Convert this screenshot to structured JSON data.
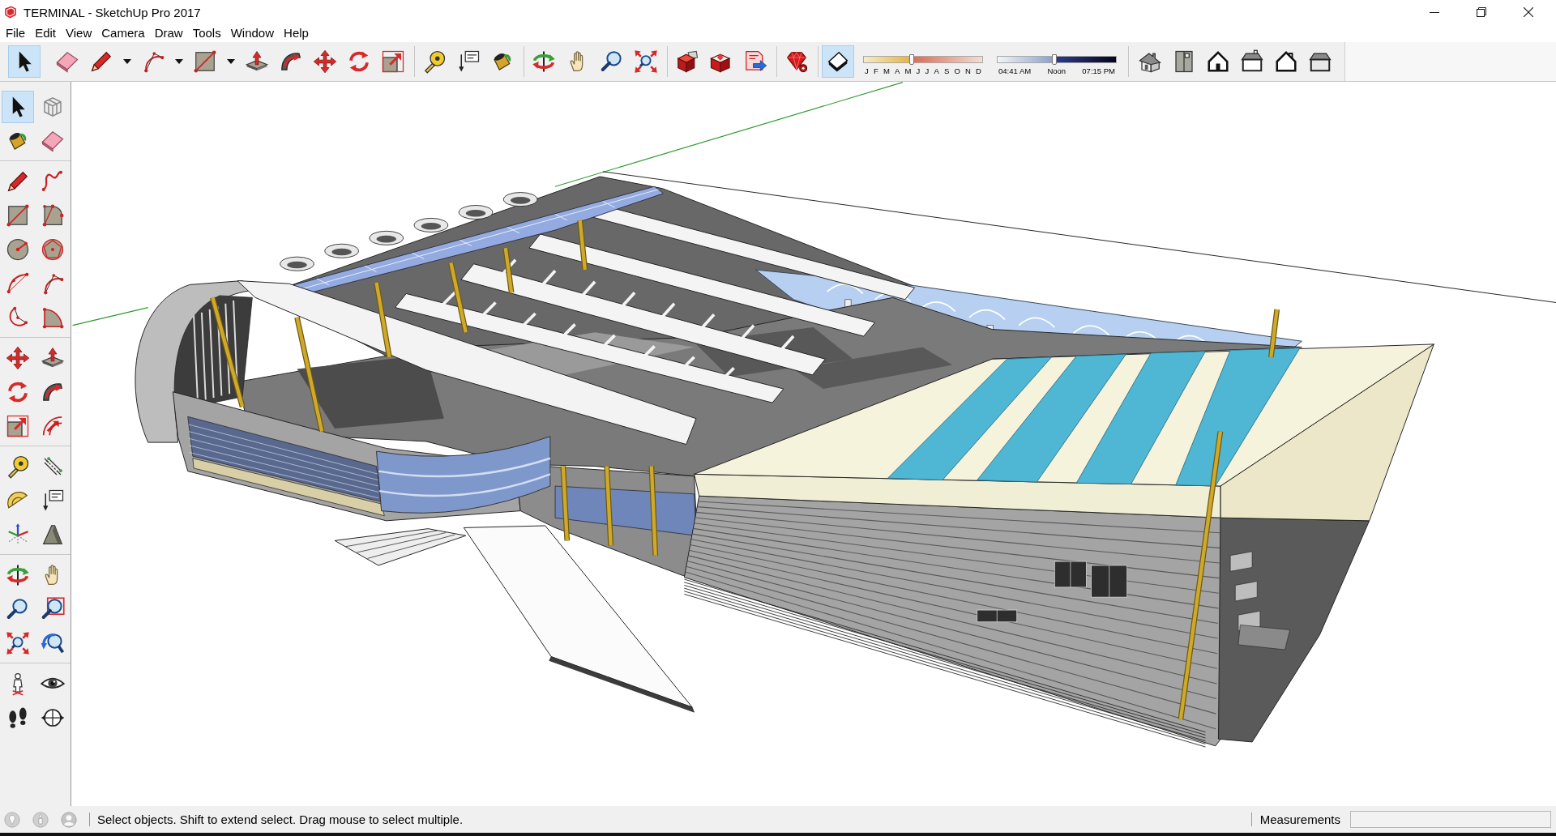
{
  "window": {
    "title": "TERMINAL - SketchUp Pro 2017"
  },
  "menu": [
    "File",
    "Edit",
    "View",
    "Camera",
    "Draw",
    "Tools",
    "Window",
    "Help"
  ],
  "toolbar": {
    "sections": [
      {
        "kind": "tools",
        "items": [
          {
            "kind": "button",
            "selected": true
          },
          {
            "kind": "button",
            "selected": false
          },
          {
            "kind": "split",
            "selected": false
          },
          {
            "kind": "split",
            "selected": false
          },
          {
            "kind": "split",
            "selected": false
          },
          {
            "kind": "button",
            "selected": false
          },
          {
            "kind": "button",
            "selected": false
          },
          {
            "kind": "button",
            "selected": false
          },
          {
            "kind": "button",
            "selected": false
          },
          {
            "kind": "button",
            "selected": false
          }
        ]
      },
      {
        "kind": "tools",
        "items": [
          {
            "kind": "button",
            "selected": false
          },
          {
            "kind": "button",
            "selected": false
          },
          {
            "kind": "button",
            "selected": false
          }
        ]
      },
      {
        "kind": "tools",
        "items": [
          {
            "kind": "button",
            "selected": false
          },
          {
            "kind": "button",
            "selected": false
          },
          {
            "kind": "button",
            "selected": false
          },
          {
            "kind": "button",
            "selected": false
          }
        ]
      },
      {
        "kind": "tools",
        "items": [
          {
            "kind": "button",
            "selected": false
          },
          {
            "kind": "button",
            "selected": false
          },
          {
            "kind": "button",
            "selected": false
          }
        ]
      },
      {
        "kind": "tools",
        "items": [
          {
            "kind": "button",
            "selected": false
          }
        ]
      },
      {
        "kind": "shadows",
        "toggle": {
          "selected": true
        },
        "month_slider": {
          "level": 0.4,
          "labels": [
            "J",
            "F",
            "M",
            "A",
            "M",
            "J",
            "J",
            "A",
            "S",
            "O",
            "N",
            "D"
          ]
        },
        "time_slider": {
          "level": 0.47,
          "labels": [
            "04:41 AM",
            "Noon",
            "07:15 PM"
          ]
        }
      },
      {
        "kind": "tools",
        "items": [
          {
            "kind": "button",
            "selected": false
          },
          {
            "kind": "button",
            "selected": false
          },
          {
            "kind": "button",
            "selected": false
          },
          {
            "kind": "button",
            "selected": false
          },
          {
            "kind": "button",
            "selected": false
          },
          {
            "kind": "button",
            "selected": false
          }
        ]
      }
    ]
  },
  "side_toolbar": {
    "groups": [
      {
        "items": [
          {
            "selected": true
          },
          {
            "selected": false
          },
          {
            "selected": false
          },
          {
            "selected": false
          }
        ]
      },
      {
        "items": [
          {
            "selected": false
          },
          {
            "selected": false
          },
          {
            "selected": false
          },
          {
            "selected": false
          },
          {
            "selected": false
          },
          {
            "selected": false
          },
          {
            "selected": false
          },
          {
            "selected": false
          },
          {
            "selected": false
          },
          {
            "selected": false
          }
        ]
      },
      {
        "items": [
          {
            "selected": false
          },
          {
            "selected": false
          },
          {
            "selected": false
          },
          {
            "selected": false
          },
          {
            "selected": false
          },
          {
            "selected": false
          }
        ]
      },
      {
        "items": [
          {
            "selected": false
          },
          {
            "selected": false
          },
          {
            "selected": false
          },
          {
            "selected": false
          },
          {
            "selected": false
          },
          {
            "selected": false
          }
        ]
      },
      {
        "items": [
          {
            "selected": false
          },
          {
            "selected": false
          },
          {
            "selected": false
          },
          {
            "selected": false
          },
          {
            "selected": false
          },
          {
            "selected": false
          }
        ]
      },
      {
        "items": [
          {
            "selected": false
          },
          {
            "selected": false
          },
          {
            "selected": false
          },
          {
            "selected": false
          }
        ]
      }
    ]
  },
  "status_bar": {
    "message": "Select objects. Shift to extend select. Drag mouse to select multiple.",
    "measurements_label": "Measurements"
  }
}
